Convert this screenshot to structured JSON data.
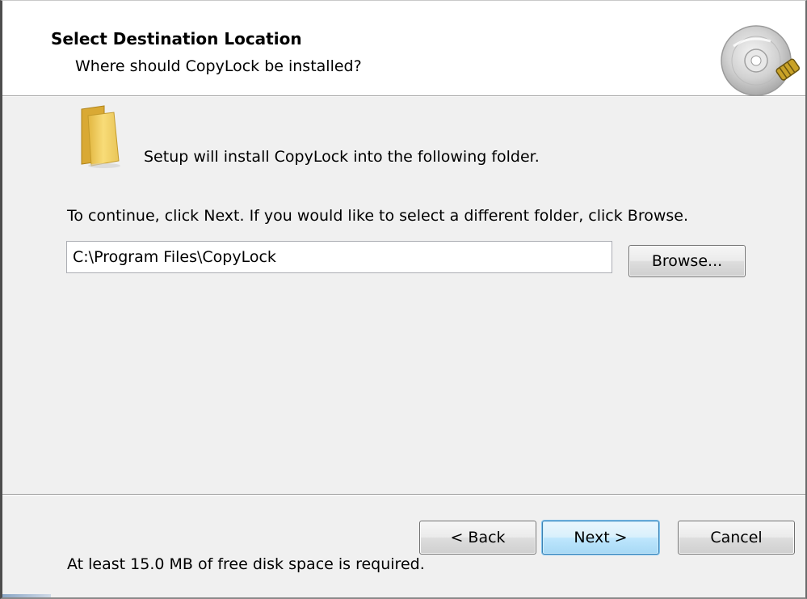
{
  "header": {
    "title": "Select Destination Location",
    "subtitle": "Where should CopyLock be installed?",
    "icon": "cd-disc-icon"
  },
  "content": {
    "folder_message": "Setup will install CopyLock into the following folder.",
    "continue_message": "To continue, click Next. If you would like to select a different folder, click Browse.",
    "install_path": "C:\\Program Files\\CopyLock",
    "browse_label": "Browse...",
    "disk_space_message": "At least 15.0 MB of free disk space is required."
  },
  "footer": {
    "back_label": "< Back",
    "next_label": "Next >",
    "cancel_label": "Cancel"
  },
  "colors": {
    "header_bg": "#ffffff",
    "body_bg": "#f0f0f0",
    "default_button_border": "#3c7fb1"
  }
}
